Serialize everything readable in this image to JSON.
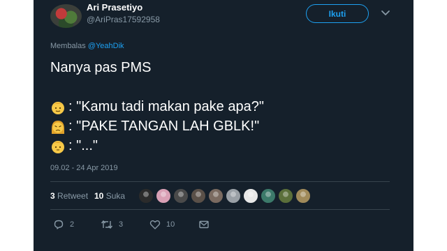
{
  "profile": {
    "display_name": "Ari Prasetiyo",
    "handle": "@AriPras17592958",
    "avatar_icon": "profile-photo"
  },
  "follow_label": "Ikuti",
  "reply": {
    "prefix": "Membalas",
    "mention": "@YeahDik"
  },
  "tweet_lines": [
    "Nanya pas PMS",
    ": \"Kamu tadi makan pake apa?\"",
    ": \"PAKE TANGAN LAH GBLK!\"",
    ": \"...\""
  ],
  "emoji_icons": [
    "man-emoji",
    "angry-woman-emoji",
    "man-emoji"
  ],
  "timestamp": "09.02 - 24 Apr 2019",
  "stats": {
    "retweets_count": "3",
    "retweets_label": "Retweet",
    "likes_count": "10",
    "likes_label": "Suka"
  },
  "likers_count": 10,
  "actions": {
    "reply_count": "2",
    "retweet_count": "3",
    "like_count": "10"
  },
  "colors": {
    "background": "#15202b",
    "accent": "#1da1f2",
    "secondary_text": "#8899a6",
    "divider": "#38444d"
  }
}
